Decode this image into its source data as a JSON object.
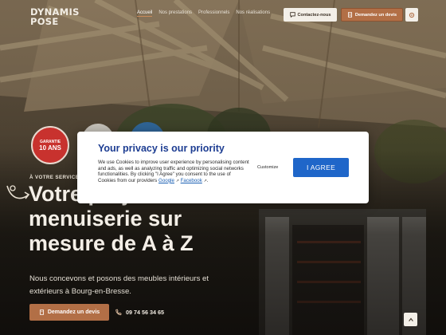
{
  "header": {
    "logo": {
      "name": "DYNAMIS POSE"
    },
    "nav": [
      {
        "label": "Accueil",
        "active": true
      },
      {
        "label": "Nos prestations",
        "active": false
      },
      {
        "label": "Professionnels",
        "active": false
      },
      {
        "label": "Nos réalisations",
        "active": false
      }
    ],
    "contact_label": "Contactez-nous",
    "devis_label": "Demandez un devis"
  },
  "badges": {
    "guarantee_line1": "GARANTIE",
    "guarantee_line2": "10 ANS"
  },
  "hero": {
    "eyebrow": "À VOTRE SERVICE",
    "title": "Votre projet de menuiserie sur mesure de A à Z",
    "description": "Nous concevons et posons des meubles intérieurs et extérieurs à Bourg-en-Bresse.",
    "cta_label": "Demandez un devis",
    "phone": "09 74 56 34 65"
  },
  "consent": {
    "title": "Your privacy is our priority",
    "text": "We use Cookies to improve user experience by personalising content and ads, as well as analyzing traffic and optimizing social networks functionalities. By clicking \"I Agree\" you consent to the use of Cookies from our providers",
    "link_google": "Google",
    "link_facebook": "Facebook",
    "customize_label": "Customize",
    "agree_label": "I AGREE"
  },
  "colors": {
    "accent": "#b26f46",
    "consent_title": "#1d3d92",
    "agree_button": "#1f66c9",
    "badge_red": "#c8322e"
  }
}
